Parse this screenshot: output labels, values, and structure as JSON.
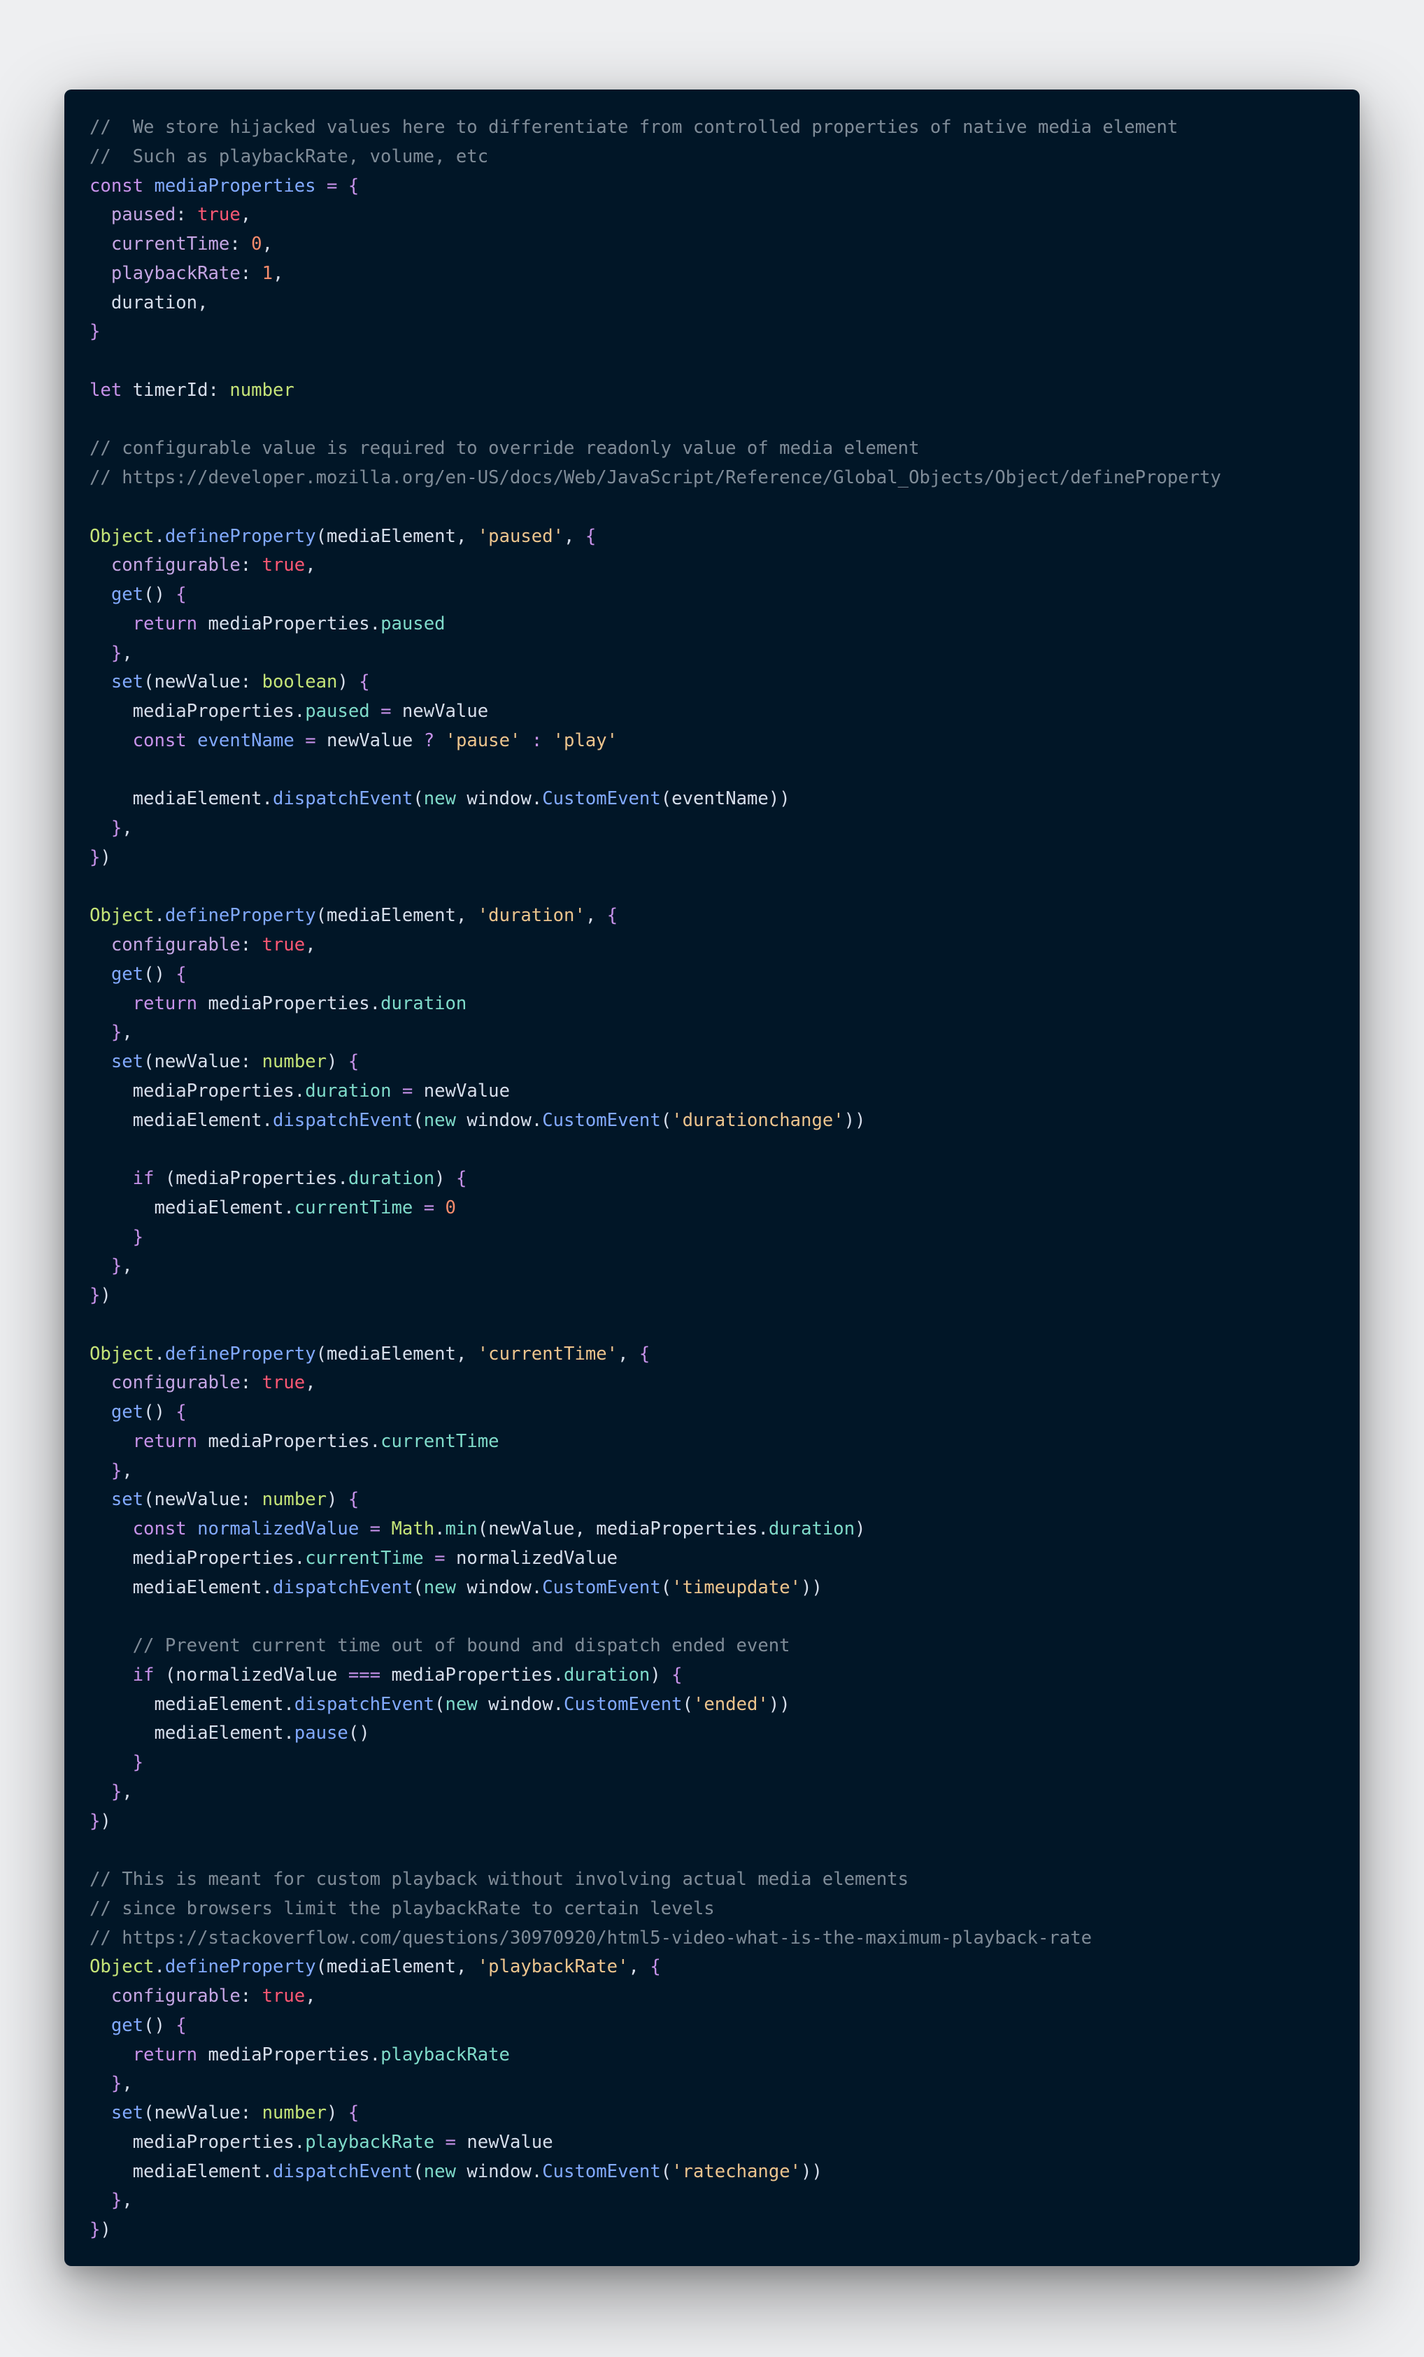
{
  "editor": {
    "language": "TypeScript",
    "theme": "Night Owl",
    "colors": {
      "background": "#011627",
      "page_background": "#eeeff1",
      "comment": "#7f8c98",
      "keyword": "#c792ea",
      "string": "#ecc48d",
      "function": "#82aaff",
      "boolean": "#ff5874",
      "number": "#f78c6c",
      "member": "#7fdbca",
      "type": "#c5e478",
      "text": "#d6deeb"
    },
    "lines": [
      [
        [
          "comment",
          "//  We store hijacked values here to differentiate from controlled properties of native media element"
        ]
      ],
      [
        [
          "comment",
          "//  Such as playbackRate, volume, etc"
        ]
      ],
      [
        [
          "keyword",
          "const "
        ],
        [
          "const",
          "mediaProperties"
        ],
        [
          "op",
          " = "
        ],
        [
          "brace",
          "{"
        ]
      ],
      [
        [
          "var",
          "  "
        ],
        [
          "prop",
          "paused"
        ],
        [
          "punct",
          ": "
        ],
        [
          "bool",
          "true"
        ],
        [
          "punct",
          ","
        ]
      ],
      [
        [
          "var",
          "  "
        ],
        [
          "prop",
          "currentTime"
        ],
        [
          "punct",
          ": "
        ],
        [
          "num",
          "0"
        ],
        [
          "punct",
          ","
        ]
      ],
      [
        [
          "var",
          "  "
        ],
        [
          "prop",
          "playbackRate"
        ],
        [
          "punct",
          ": "
        ],
        [
          "num",
          "1"
        ],
        [
          "punct",
          ","
        ]
      ],
      [
        [
          "var",
          "  duration"
        ],
        [
          "punct",
          ","
        ]
      ],
      [
        [
          "brace",
          "}"
        ]
      ],
      [],
      [
        [
          "keyword",
          "let "
        ],
        [
          "var",
          "timerId"
        ],
        [
          "punct",
          ": "
        ],
        [
          "type",
          "number"
        ]
      ],
      [],
      [
        [
          "comment",
          "// configurable value is required to override readonly value of media element"
        ]
      ],
      [
        [
          "comment",
          "// https://developer.mozilla.org/en-US/docs/Web/JavaScript/Reference/Global_Objects/Object/defineProperty"
        ]
      ],
      [],
      [
        [
          "class",
          "Object"
        ],
        [
          "punct",
          "."
        ],
        [
          "func",
          "defineProperty"
        ],
        [
          "punct",
          "("
        ],
        [
          "var",
          "mediaElement"
        ],
        [
          "punct",
          ", "
        ],
        [
          "string",
          "'paused'"
        ],
        [
          "punct",
          ", "
        ],
        [
          "brace",
          "{"
        ]
      ],
      [
        [
          "var",
          "  "
        ],
        [
          "prop",
          "configurable"
        ],
        [
          "punct",
          ": "
        ],
        [
          "bool",
          "true"
        ],
        [
          "punct",
          ","
        ]
      ],
      [
        [
          "var",
          "  "
        ],
        [
          "func",
          "get"
        ],
        [
          "punct",
          "() "
        ],
        [
          "brace",
          "{"
        ]
      ],
      [
        [
          "keyword",
          "    return "
        ],
        [
          "var",
          "mediaProperties"
        ],
        [
          "punct",
          "."
        ],
        [
          "member",
          "paused"
        ]
      ],
      [
        [
          "var",
          "  "
        ],
        [
          "brace",
          "}"
        ],
        [
          "punct",
          ","
        ]
      ],
      [
        [
          "var",
          "  "
        ],
        [
          "func",
          "set"
        ],
        [
          "punct",
          "("
        ],
        [
          "var",
          "newValue"
        ],
        [
          "punct",
          ": "
        ],
        [
          "type",
          "boolean"
        ],
        [
          "punct",
          ") "
        ],
        [
          "brace",
          "{"
        ]
      ],
      [
        [
          "var",
          "    mediaProperties"
        ],
        [
          "punct",
          "."
        ],
        [
          "member",
          "paused"
        ],
        [
          "op",
          " = "
        ],
        [
          "var",
          "newValue"
        ]
      ],
      [
        [
          "keyword",
          "    const "
        ],
        [
          "const",
          "eventName"
        ],
        [
          "op",
          " = "
        ],
        [
          "var",
          "newValue"
        ],
        [
          "op",
          " ? "
        ],
        [
          "string",
          "'pause'"
        ],
        [
          "op",
          " : "
        ],
        [
          "string",
          "'play'"
        ]
      ],
      [],
      [
        [
          "var",
          "    mediaElement"
        ],
        [
          "punct",
          "."
        ],
        [
          "func",
          "dispatchEvent"
        ],
        [
          "punct",
          "("
        ],
        [
          "member",
          "new "
        ],
        [
          "var",
          "window"
        ],
        [
          "punct",
          "."
        ],
        [
          "func",
          "CustomEvent"
        ],
        [
          "punct",
          "("
        ],
        [
          "var",
          "eventName"
        ],
        [
          "punct",
          "))"
        ]
      ],
      [
        [
          "var",
          "  "
        ],
        [
          "brace",
          "}"
        ],
        [
          "punct",
          ","
        ]
      ],
      [
        [
          "brace",
          "}"
        ],
        [
          "punct",
          ")"
        ]
      ],
      [],
      [
        [
          "class",
          "Object"
        ],
        [
          "punct",
          "."
        ],
        [
          "func",
          "defineProperty"
        ],
        [
          "punct",
          "("
        ],
        [
          "var",
          "mediaElement"
        ],
        [
          "punct",
          ", "
        ],
        [
          "string",
          "'duration'"
        ],
        [
          "punct",
          ", "
        ],
        [
          "brace",
          "{"
        ]
      ],
      [
        [
          "var",
          "  "
        ],
        [
          "prop",
          "configurable"
        ],
        [
          "punct",
          ": "
        ],
        [
          "bool",
          "true"
        ],
        [
          "punct",
          ","
        ]
      ],
      [
        [
          "var",
          "  "
        ],
        [
          "func",
          "get"
        ],
        [
          "punct",
          "() "
        ],
        [
          "brace",
          "{"
        ]
      ],
      [
        [
          "keyword",
          "    return "
        ],
        [
          "var",
          "mediaProperties"
        ],
        [
          "punct",
          "."
        ],
        [
          "member",
          "duration"
        ]
      ],
      [
        [
          "var",
          "  "
        ],
        [
          "brace",
          "}"
        ],
        [
          "punct",
          ","
        ]
      ],
      [
        [
          "var",
          "  "
        ],
        [
          "func",
          "set"
        ],
        [
          "punct",
          "("
        ],
        [
          "var",
          "newValue"
        ],
        [
          "punct",
          ": "
        ],
        [
          "type",
          "number"
        ],
        [
          "punct",
          ") "
        ],
        [
          "brace",
          "{"
        ]
      ],
      [
        [
          "var",
          "    mediaProperties"
        ],
        [
          "punct",
          "."
        ],
        [
          "member",
          "duration"
        ],
        [
          "op",
          " = "
        ],
        [
          "var",
          "newValue"
        ]
      ],
      [
        [
          "var",
          "    mediaElement"
        ],
        [
          "punct",
          "."
        ],
        [
          "func",
          "dispatchEvent"
        ],
        [
          "punct",
          "("
        ],
        [
          "member",
          "new "
        ],
        [
          "var",
          "window"
        ],
        [
          "punct",
          "."
        ],
        [
          "func",
          "CustomEvent"
        ],
        [
          "punct",
          "("
        ],
        [
          "string",
          "'durationchange'"
        ],
        [
          "punct",
          "))"
        ]
      ],
      [],
      [
        [
          "keyword",
          "    if "
        ],
        [
          "punct",
          "("
        ],
        [
          "var",
          "mediaProperties"
        ],
        [
          "punct",
          "."
        ],
        [
          "member",
          "duration"
        ],
        [
          "punct",
          ") "
        ],
        [
          "brace",
          "{"
        ]
      ],
      [
        [
          "var",
          "      mediaElement"
        ],
        [
          "punct",
          "."
        ],
        [
          "member",
          "currentTime"
        ],
        [
          "op",
          " = "
        ],
        [
          "num",
          "0"
        ]
      ],
      [
        [
          "var",
          "    "
        ],
        [
          "brace",
          "}"
        ]
      ],
      [
        [
          "var",
          "  "
        ],
        [
          "brace",
          "}"
        ],
        [
          "punct",
          ","
        ]
      ],
      [
        [
          "brace",
          "}"
        ],
        [
          "punct",
          ")"
        ]
      ],
      [],
      [
        [
          "class",
          "Object"
        ],
        [
          "punct",
          "."
        ],
        [
          "func",
          "defineProperty"
        ],
        [
          "punct",
          "("
        ],
        [
          "var",
          "mediaElement"
        ],
        [
          "punct",
          ", "
        ],
        [
          "string",
          "'currentTime'"
        ],
        [
          "punct",
          ", "
        ],
        [
          "brace",
          "{"
        ]
      ],
      [
        [
          "var",
          "  "
        ],
        [
          "prop",
          "configurable"
        ],
        [
          "punct",
          ": "
        ],
        [
          "bool",
          "true"
        ],
        [
          "punct",
          ","
        ]
      ],
      [
        [
          "var",
          "  "
        ],
        [
          "func",
          "get"
        ],
        [
          "punct",
          "() "
        ],
        [
          "brace",
          "{"
        ]
      ],
      [
        [
          "keyword",
          "    return "
        ],
        [
          "var",
          "mediaProperties"
        ],
        [
          "punct",
          "."
        ],
        [
          "member",
          "currentTime"
        ]
      ],
      [
        [
          "var",
          "  "
        ],
        [
          "brace",
          "}"
        ],
        [
          "punct",
          ","
        ]
      ],
      [
        [
          "var",
          "  "
        ],
        [
          "func",
          "set"
        ],
        [
          "punct",
          "("
        ],
        [
          "var",
          "newValue"
        ],
        [
          "punct",
          ": "
        ],
        [
          "type",
          "number"
        ],
        [
          "punct",
          ") "
        ],
        [
          "brace",
          "{"
        ]
      ],
      [
        [
          "keyword",
          "    const "
        ],
        [
          "const",
          "normalizedValue"
        ],
        [
          "op",
          " = "
        ],
        [
          "class",
          "Math"
        ],
        [
          "punct",
          "."
        ],
        [
          "member",
          "min"
        ],
        [
          "punct",
          "("
        ],
        [
          "var",
          "newValue"
        ],
        [
          "punct",
          ", "
        ],
        [
          "var",
          "mediaProperties"
        ],
        [
          "punct",
          "."
        ],
        [
          "member",
          "duration"
        ],
        [
          "punct",
          ")"
        ]
      ],
      [
        [
          "var",
          "    mediaProperties"
        ],
        [
          "punct",
          "."
        ],
        [
          "member",
          "currentTime"
        ],
        [
          "op",
          " = "
        ],
        [
          "var",
          "normalizedValue"
        ]
      ],
      [
        [
          "var",
          "    mediaElement"
        ],
        [
          "punct",
          "."
        ],
        [
          "func",
          "dispatchEvent"
        ],
        [
          "punct",
          "("
        ],
        [
          "member",
          "new "
        ],
        [
          "var",
          "window"
        ],
        [
          "punct",
          "."
        ],
        [
          "func",
          "CustomEvent"
        ],
        [
          "punct",
          "("
        ],
        [
          "string",
          "'timeupdate'"
        ],
        [
          "punct",
          "))"
        ]
      ],
      [],
      [
        [
          "comment",
          "    // Prevent current time out of bound and dispatch ended event"
        ]
      ],
      [
        [
          "keyword",
          "    if "
        ],
        [
          "punct",
          "("
        ],
        [
          "var",
          "normalizedValue "
        ],
        [
          "op",
          "==="
        ],
        [
          "var",
          " mediaProperties"
        ],
        [
          "punct",
          "."
        ],
        [
          "member",
          "duration"
        ],
        [
          "punct",
          ") "
        ],
        [
          "brace",
          "{"
        ]
      ],
      [
        [
          "var",
          "      mediaElement"
        ],
        [
          "punct",
          "."
        ],
        [
          "func",
          "dispatchEvent"
        ],
        [
          "punct",
          "("
        ],
        [
          "member",
          "new "
        ],
        [
          "var",
          "window"
        ],
        [
          "punct",
          "."
        ],
        [
          "func",
          "CustomEvent"
        ],
        [
          "punct",
          "("
        ],
        [
          "string",
          "'ended'"
        ],
        [
          "punct",
          "))"
        ]
      ],
      [
        [
          "var",
          "      mediaElement"
        ],
        [
          "punct",
          "."
        ],
        [
          "func",
          "pause"
        ],
        [
          "punct",
          "()"
        ]
      ],
      [
        [
          "var",
          "    "
        ],
        [
          "brace",
          "}"
        ]
      ],
      [
        [
          "var",
          "  "
        ],
        [
          "brace",
          "}"
        ],
        [
          "punct",
          ","
        ]
      ],
      [
        [
          "brace",
          "}"
        ],
        [
          "punct",
          ")"
        ]
      ],
      [],
      [
        [
          "comment",
          "// This is meant for custom playback without involving actual media elements"
        ]
      ],
      [
        [
          "comment",
          "// since browsers limit the playbackRate to certain levels"
        ]
      ],
      [
        [
          "comment",
          "// https://stackoverflow.com/questions/30970920/html5-video-what-is-the-maximum-playback-rate"
        ]
      ],
      [
        [
          "class",
          "Object"
        ],
        [
          "punct",
          "."
        ],
        [
          "func",
          "defineProperty"
        ],
        [
          "punct",
          "("
        ],
        [
          "var",
          "mediaElement"
        ],
        [
          "punct",
          ", "
        ],
        [
          "string",
          "'playbackRate'"
        ],
        [
          "punct",
          ", "
        ],
        [
          "brace",
          "{"
        ]
      ],
      [
        [
          "var",
          "  "
        ],
        [
          "prop",
          "configurable"
        ],
        [
          "punct",
          ": "
        ],
        [
          "bool",
          "true"
        ],
        [
          "punct",
          ","
        ]
      ],
      [
        [
          "var",
          "  "
        ],
        [
          "func",
          "get"
        ],
        [
          "punct",
          "() "
        ],
        [
          "brace",
          "{"
        ]
      ],
      [
        [
          "keyword",
          "    return "
        ],
        [
          "var",
          "mediaProperties"
        ],
        [
          "punct",
          "."
        ],
        [
          "member",
          "playbackRate"
        ]
      ],
      [
        [
          "var",
          "  "
        ],
        [
          "brace",
          "}"
        ],
        [
          "punct",
          ","
        ]
      ],
      [
        [
          "var",
          "  "
        ],
        [
          "func",
          "set"
        ],
        [
          "punct",
          "("
        ],
        [
          "var",
          "newValue"
        ],
        [
          "punct",
          ": "
        ],
        [
          "type",
          "number"
        ],
        [
          "punct",
          ") "
        ],
        [
          "brace",
          "{"
        ]
      ],
      [
        [
          "var",
          "    mediaProperties"
        ],
        [
          "punct",
          "."
        ],
        [
          "member",
          "playbackRate"
        ],
        [
          "op",
          " = "
        ],
        [
          "var",
          "newValue"
        ]
      ],
      [
        [
          "var",
          "    mediaElement"
        ],
        [
          "punct",
          "."
        ],
        [
          "func",
          "dispatchEvent"
        ],
        [
          "punct",
          "("
        ],
        [
          "member",
          "new "
        ],
        [
          "var",
          "window"
        ],
        [
          "punct",
          "."
        ],
        [
          "func",
          "CustomEvent"
        ],
        [
          "punct",
          "("
        ],
        [
          "string",
          "'ratechange'"
        ],
        [
          "punct",
          "))"
        ]
      ],
      [
        [
          "var",
          "  "
        ],
        [
          "brace",
          "}"
        ],
        [
          "punct",
          ","
        ]
      ],
      [
        [
          "brace",
          "}"
        ],
        [
          "punct",
          ")"
        ]
      ]
    ]
  }
}
